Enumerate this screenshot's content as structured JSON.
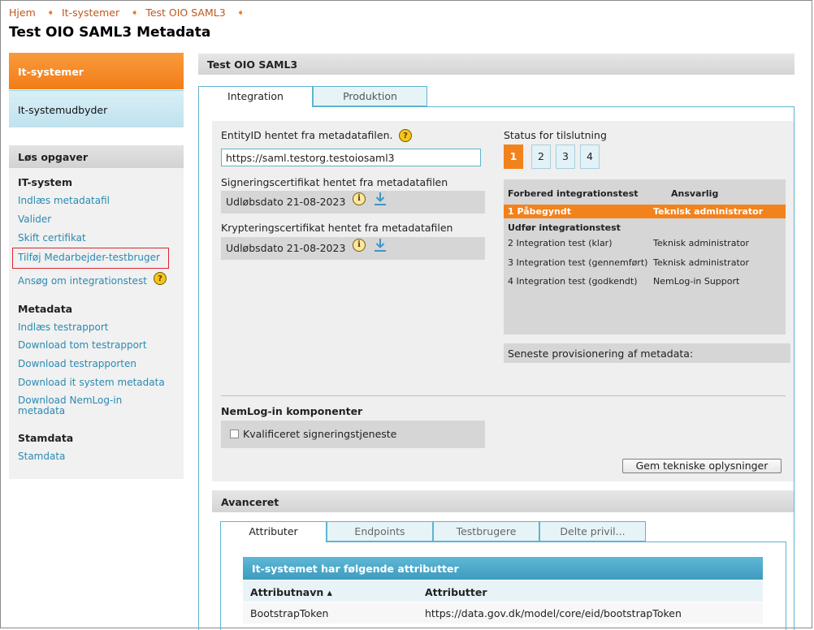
{
  "breadcrumb": {
    "items": [
      "Hjem",
      "It-systemer",
      "Test OIO SAML3"
    ],
    "separator": "➧"
  },
  "page_title": "Test OIO SAML3 Metadata",
  "nav": {
    "active": "It-systemer",
    "inactive": "It-systemudbyder"
  },
  "sidebar": {
    "title": "Løs opgaver",
    "sections": [
      {
        "heading": "IT-system",
        "links": [
          "Indlæs metadatafil",
          "Valider",
          "Skift certifikat",
          "Tilføj Medarbejder-testbruger",
          "Ansøg om integrationstest"
        ]
      },
      {
        "heading": "Metadata",
        "links": [
          "Indlæs testrapport",
          "Download tom testrapport",
          "Download testrapporten",
          "Download it system metadata",
          "Download NemLog-in metadata"
        ]
      },
      {
        "heading": "Stamdata",
        "links": [
          "Stamdata"
        ]
      }
    ]
  },
  "main": {
    "header": "Test OIO SAML3",
    "tabs": [
      "Integration",
      "Produktion"
    ],
    "entity_label": "EntityID hentet fra metadatafilen.",
    "entity_value": "https://saml.testorg.testoiosaml3",
    "sign_cert_label": "Signeringscertifikat hentet fra metadatafilen",
    "sign_cert_value": "Udløbsdato 21-08-2023",
    "crypt_cert_label": "Krypteringscertifikat hentet fra metadatafilen",
    "crypt_cert_value": "Udløbsdato 21-08-2023",
    "status_label": "Status for tilslutning",
    "steps": [
      "1",
      "2",
      "3",
      "4"
    ],
    "active_step": "1",
    "status_table": {
      "col1": "Forbered integrationstest",
      "col2": "Ansvarlig",
      "rows": [
        {
          "step": "1 Påbegyndt",
          "resp": "Teknisk administrator",
          "active": true
        },
        {
          "section": "Udfør integrationstest"
        },
        {
          "step": "2 Integration test (klar)",
          "resp": "Teknisk administrator"
        },
        {
          "step": "3 Integration test (gennemført)",
          "resp": "Teknisk administrator"
        },
        {
          "step": "4 Integration test (godkendt)",
          "resp": "NemLog-in Support"
        }
      ]
    },
    "provisioning_label": "Seneste provisionering af metadata:",
    "nemlog_title": "NemLog-in komponenter",
    "checkbox_label": "Kvalificeret signeringstjeneste",
    "save_button": "Gem tekniske oplysninger"
  },
  "advanced": {
    "title": "Avanceret",
    "tabs": [
      "Attributer",
      "Endpoints",
      "Testbrugere",
      "Delte privil..."
    ],
    "attr_header": "It-systemet har følgende attributter",
    "col_name": "Attributnavn ▴",
    "col_value": "Attributter",
    "rows": [
      {
        "name": "BootstrapToken",
        "value": "https://data.gov.dk/model/core/eid/bootstrapToken"
      }
    ]
  },
  "colors": {
    "accent_orange": "#f2821b",
    "accent_blue": "#5fb4cf",
    "link_blue": "#2a8ab2",
    "highlight_red": "#d9262d"
  }
}
